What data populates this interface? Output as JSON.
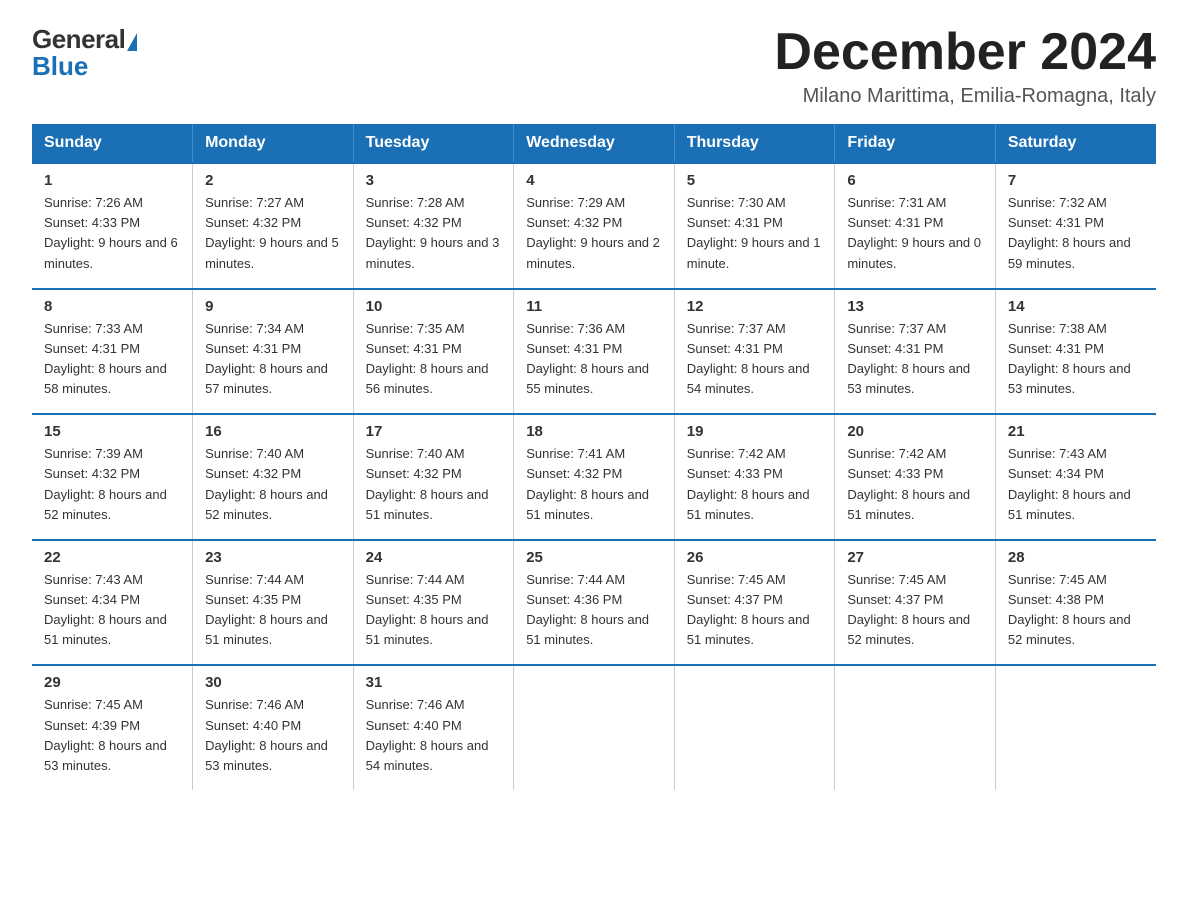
{
  "logo": {
    "general": "General",
    "blue": "Blue"
  },
  "title": "December 2024",
  "location": "Milano Marittima, Emilia-Romagna, Italy",
  "days_of_week": [
    "Sunday",
    "Monday",
    "Tuesday",
    "Wednesday",
    "Thursday",
    "Friday",
    "Saturday"
  ],
  "weeks": [
    [
      {
        "day": "1",
        "sunrise": "7:26 AM",
        "sunset": "4:33 PM",
        "daylight": "9 hours and 6 minutes."
      },
      {
        "day": "2",
        "sunrise": "7:27 AM",
        "sunset": "4:32 PM",
        "daylight": "9 hours and 5 minutes."
      },
      {
        "day": "3",
        "sunrise": "7:28 AM",
        "sunset": "4:32 PM",
        "daylight": "9 hours and 3 minutes."
      },
      {
        "day": "4",
        "sunrise": "7:29 AM",
        "sunset": "4:32 PM",
        "daylight": "9 hours and 2 minutes."
      },
      {
        "day": "5",
        "sunrise": "7:30 AM",
        "sunset": "4:31 PM",
        "daylight": "9 hours and 1 minute."
      },
      {
        "day": "6",
        "sunrise": "7:31 AM",
        "sunset": "4:31 PM",
        "daylight": "9 hours and 0 minutes."
      },
      {
        "day": "7",
        "sunrise": "7:32 AM",
        "sunset": "4:31 PM",
        "daylight": "8 hours and 59 minutes."
      }
    ],
    [
      {
        "day": "8",
        "sunrise": "7:33 AM",
        "sunset": "4:31 PM",
        "daylight": "8 hours and 58 minutes."
      },
      {
        "day": "9",
        "sunrise": "7:34 AM",
        "sunset": "4:31 PM",
        "daylight": "8 hours and 57 minutes."
      },
      {
        "day": "10",
        "sunrise": "7:35 AM",
        "sunset": "4:31 PM",
        "daylight": "8 hours and 56 minutes."
      },
      {
        "day": "11",
        "sunrise": "7:36 AM",
        "sunset": "4:31 PM",
        "daylight": "8 hours and 55 minutes."
      },
      {
        "day": "12",
        "sunrise": "7:37 AM",
        "sunset": "4:31 PM",
        "daylight": "8 hours and 54 minutes."
      },
      {
        "day": "13",
        "sunrise": "7:37 AM",
        "sunset": "4:31 PM",
        "daylight": "8 hours and 53 minutes."
      },
      {
        "day": "14",
        "sunrise": "7:38 AM",
        "sunset": "4:31 PM",
        "daylight": "8 hours and 53 minutes."
      }
    ],
    [
      {
        "day": "15",
        "sunrise": "7:39 AM",
        "sunset": "4:32 PM",
        "daylight": "8 hours and 52 minutes."
      },
      {
        "day": "16",
        "sunrise": "7:40 AM",
        "sunset": "4:32 PM",
        "daylight": "8 hours and 52 minutes."
      },
      {
        "day": "17",
        "sunrise": "7:40 AM",
        "sunset": "4:32 PM",
        "daylight": "8 hours and 51 minutes."
      },
      {
        "day": "18",
        "sunrise": "7:41 AM",
        "sunset": "4:32 PM",
        "daylight": "8 hours and 51 minutes."
      },
      {
        "day": "19",
        "sunrise": "7:42 AM",
        "sunset": "4:33 PM",
        "daylight": "8 hours and 51 minutes."
      },
      {
        "day": "20",
        "sunrise": "7:42 AM",
        "sunset": "4:33 PM",
        "daylight": "8 hours and 51 minutes."
      },
      {
        "day": "21",
        "sunrise": "7:43 AM",
        "sunset": "4:34 PM",
        "daylight": "8 hours and 51 minutes."
      }
    ],
    [
      {
        "day": "22",
        "sunrise": "7:43 AM",
        "sunset": "4:34 PM",
        "daylight": "8 hours and 51 minutes."
      },
      {
        "day": "23",
        "sunrise": "7:44 AM",
        "sunset": "4:35 PM",
        "daylight": "8 hours and 51 minutes."
      },
      {
        "day": "24",
        "sunrise": "7:44 AM",
        "sunset": "4:35 PM",
        "daylight": "8 hours and 51 minutes."
      },
      {
        "day": "25",
        "sunrise": "7:44 AM",
        "sunset": "4:36 PM",
        "daylight": "8 hours and 51 minutes."
      },
      {
        "day": "26",
        "sunrise": "7:45 AM",
        "sunset": "4:37 PM",
        "daylight": "8 hours and 51 minutes."
      },
      {
        "day": "27",
        "sunrise": "7:45 AM",
        "sunset": "4:37 PM",
        "daylight": "8 hours and 52 minutes."
      },
      {
        "day": "28",
        "sunrise": "7:45 AM",
        "sunset": "4:38 PM",
        "daylight": "8 hours and 52 minutes."
      }
    ],
    [
      {
        "day": "29",
        "sunrise": "7:45 AM",
        "sunset": "4:39 PM",
        "daylight": "8 hours and 53 minutes."
      },
      {
        "day": "30",
        "sunrise": "7:46 AM",
        "sunset": "4:40 PM",
        "daylight": "8 hours and 53 minutes."
      },
      {
        "day": "31",
        "sunrise": "7:46 AM",
        "sunset": "4:40 PM",
        "daylight": "8 hours and 54 minutes."
      },
      null,
      null,
      null,
      null
    ]
  ],
  "labels": {
    "sunrise": "Sunrise:",
    "sunset": "Sunset:",
    "daylight": "Daylight:"
  }
}
